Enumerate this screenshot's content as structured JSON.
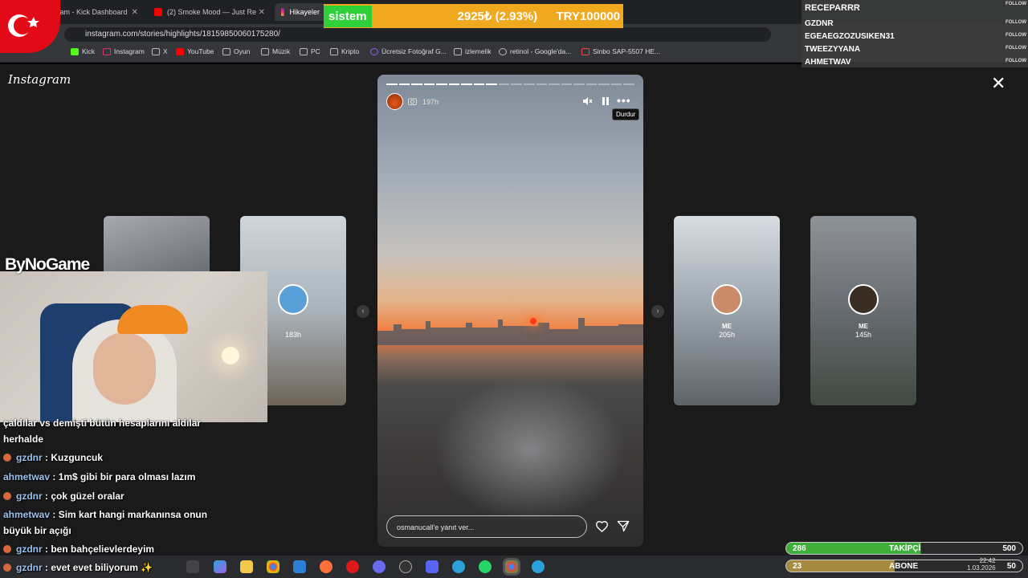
{
  "browser": {
    "tabs": [
      {
        "label": "Stream - Kick Dashboard"
      },
      {
        "label": "(2) Smoke Mood — Just Re"
      },
      {
        "label": "Hikayeler"
      }
    ],
    "url": "instagram.com/stories/highlights/18159850060175280/",
    "bookmarks": [
      "Kick",
      "Instagram",
      "X",
      "YouTube",
      "Oyun",
      "Müzik",
      "PC",
      "Kripto",
      "Ücretsiz Fotoğraf G...",
      "izlemelik",
      "retinol - Google'da...",
      "Sinbo SAP-5507 HE..."
    ]
  },
  "instagram": {
    "logo": "Instagram",
    "story": {
      "time": "197h",
      "tooltip": "Durdur",
      "reply_placeholder": "osmanucall'e yanıt ver...",
      "progress_total": 20,
      "progress_done": 9
    },
    "thumbs_left": [
      {
        "time": "183h"
      }
    ],
    "thumbs_right": [
      {
        "name": "ME",
        "time": "205h"
      },
      {
        "name": "ME",
        "time": "145h"
      }
    ]
  },
  "overlay": {
    "ticker_label": "sistem",
    "ticker_value": "2925₺ (2.93%)",
    "ticker_goal": "TRY100000",
    "follow_badge": "FOLLOW",
    "followers": [
      "RECEPARRR",
      "GZDNR",
      "EGEAEGZOZUSIKEN31",
      "TWEEZYYANA",
      "AHMETWAV"
    ],
    "sponsor": "ByNoGame",
    "follow_bar": {
      "left": "286",
      "center": "TAKİPÇİ",
      "right": "500"
    },
    "sub_bar": {
      "left": "23",
      "center": "ABONE",
      "right": "50"
    }
  },
  "chat": [
    {
      "user": "",
      "text": "çaldılar vs demişti bütün hesaplarını aldılar"
    },
    {
      "user": "",
      "text": "herhalde"
    },
    {
      "user": "gzdnr",
      "text": "Kuzguncuk"
    },
    {
      "user": "ahmetwav",
      "text": "1m$ gibi bir para olması lazım"
    },
    {
      "user": "gzdnr",
      "text": "çok güzel oralar"
    },
    {
      "user": "ahmetwav",
      "text": "Sim kart hangi markanınsa onun"
    },
    {
      "user": "",
      "text": "büyük bir açığı"
    },
    {
      "user": "gzdnr",
      "text": "ben bahçelievlerdeyim"
    },
    {
      "user": "gzdnr",
      "text": "evet evet biliyorum"
    }
  ],
  "taskbar": {
    "time": "22:42",
    "date": "1.03.2026"
  },
  "colors": {
    "ticker_bg": "#f0a81e",
    "ticker_label_bg": "#2fd03a",
    "bar_green": "#3fae3a",
    "chat_user": "#9bc3f0"
  }
}
